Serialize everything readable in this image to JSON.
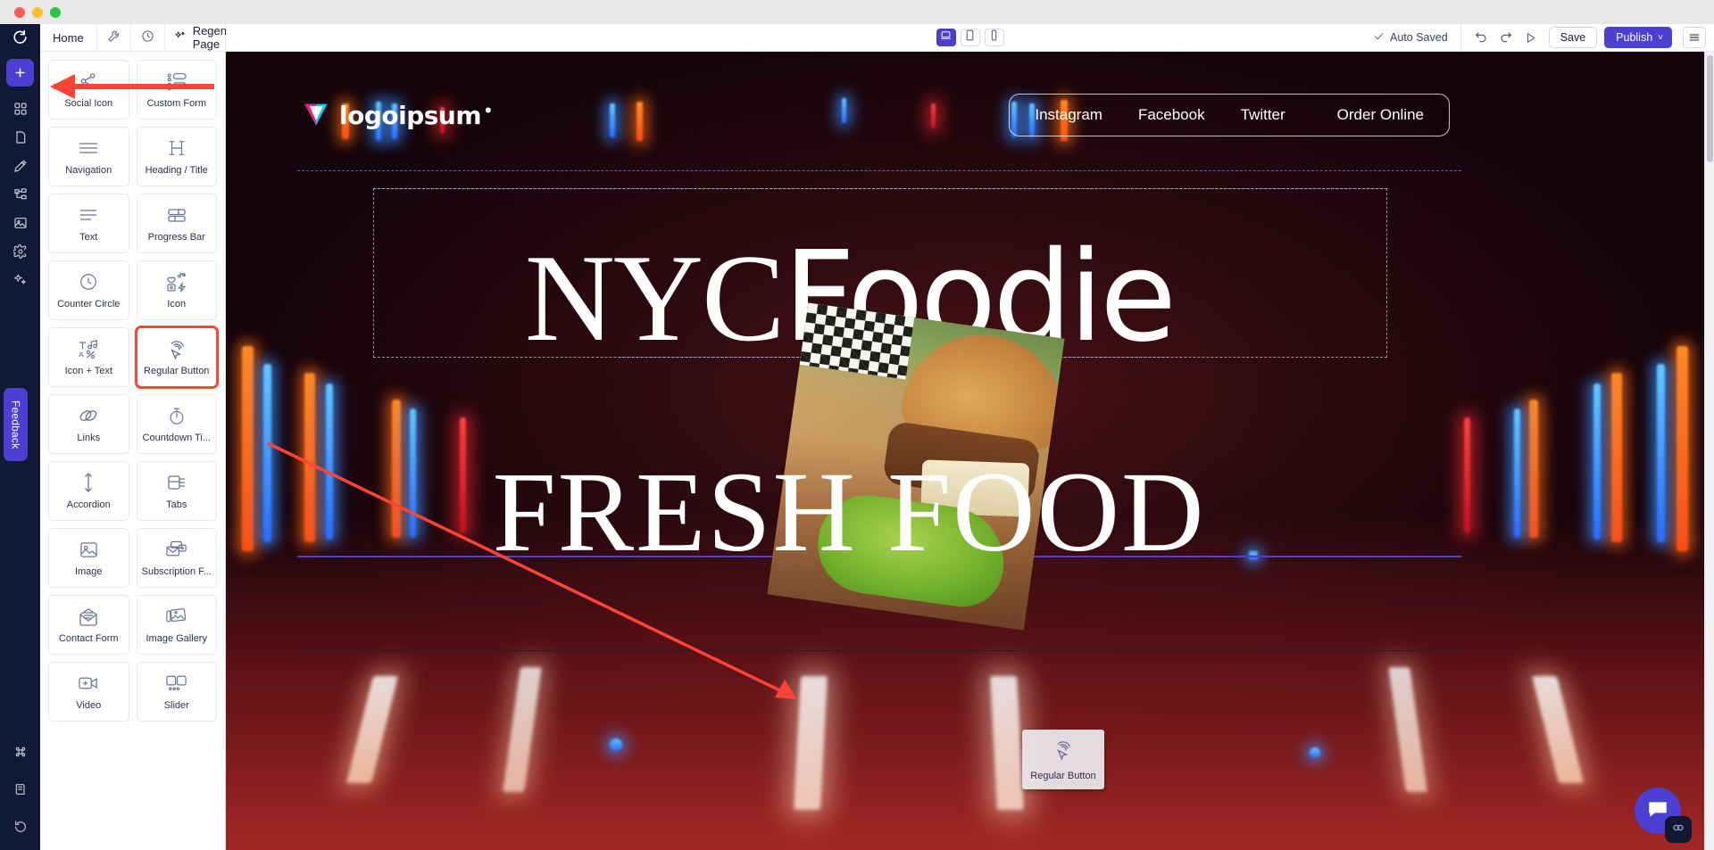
{
  "window": {
    "traffic_lights": [
      "close",
      "minimize",
      "maximize"
    ]
  },
  "rail": {
    "logo_icon": "refresh-logo-icon",
    "items": [
      {
        "name": "add-element",
        "icon": "plus-icon",
        "active": true
      },
      {
        "name": "sections",
        "icon": "grid-blocks-icon"
      },
      {
        "name": "pages",
        "icon": "page-icon"
      },
      {
        "name": "design",
        "icon": "brush-icon"
      },
      {
        "name": "layers",
        "icon": "tree-layers-icon"
      },
      {
        "name": "media",
        "icon": "image-icon"
      },
      {
        "name": "settings",
        "icon": "gear-icon"
      },
      {
        "name": "ai-assist",
        "icon": "sparkle-icon"
      }
    ],
    "feedback_label": "Feedback",
    "bottom_items": [
      {
        "name": "shortcuts",
        "icon": "command-icon"
      },
      {
        "name": "docs",
        "icon": "book-icon"
      },
      {
        "name": "history",
        "icon": "restore-icon"
      }
    ]
  },
  "panel": {
    "tabs": [
      {
        "label": "Home",
        "name": "tab-home",
        "icon": null
      },
      {
        "label": "",
        "name": "tab-tools",
        "icon": "wrench-icon"
      },
      {
        "label": "",
        "name": "tab-history",
        "icon": "clock-icon"
      }
    ],
    "regenerate": {
      "label": "Regenerate Page",
      "icon": "sparkle-icon",
      "chevron": "˅"
    },
    "widgets": [
      {
        "label": "Social Icon",
        "icon": "share-nodes-icon"
      },
      {
        "label": "Custom Form",
        "icon": "form-fields-icon"
      },
      {
        "label": "Navigation",
        "icon": "nav-lines-icon"
      },
      {
        "label": "Heading / Title",
        "icon": "heading-h-icon"
      },
      {
        "label": "Text",
        "icon": "text-lines-icon"
      },
      {
        "label": "Progress Bar",
        "icon": "progress-bars-icon"
      },
      {
        "label": "Counter Circle",
        "icon": "clock-circle-icon"
      },
      {
        "label": "Icon",
        "icon": "icon-set-icon"
      },
      {
        "label": "Icon + Text",
        "icon": "icon-text-icon"
      },
      {
        "label": "Regular Button",
        "icon": "cursor-click-icon",
        "selected": true
      },
      {
        "label": "Links",
        "icon": "chain-link-icon"
      },
      {
        "label": "Countdown Ti...",
        "icon": "stopwatch-icon"
      },
      {
        "label": "Accordion",
        "icon": "arrows-vertical-icon"
      },
      {
        "label": "Tabs",
        "icon": "tabs-panel-icon"
      },
      {
        "label": "Image",
        "icon": "image-icon"
      },
      {
        "label": "Subscription F...",
        "icon": "envelope-cards-icon"
      },
      {
        "label": "Contact Form",
        "icon": "envelope-open-icon"
      },
      {
        "label": "Image Gallery",
        "icon": "gallery-icon"
      },
      {
        "label": "Video",
        "icon": "video-plus-icon"
      },
      {
        "label": "Slider",
        "icon": "slider-cards-icon"
      }
    ]
  },
  "toolbar": {
    "devices": [
      {
        "name": "desktop",
        "icon": "laptop-icon",
        "active": true
      },
      {
        "name": "tablet",
        "icon": "tablet-icon",
        "active": false
      },
      {
        "name": "mobile",
        "icon": "phone-icon",
        "active": false
      }
    ],
    "auto_saved": "Auto Saved",
    "auto_saved_icon": "check-icon",
    "undo_icon": "undo-icon",
    "redo_icon": "redo-icon",
    "preview_icon": "play-triangle-icon",
    "save_label": "Save",
    "publish_label": "Publish",
    "publish_chevron": "˅",
    "menu_icon": "hamburger-icon"
  },
  "canvas": {
    "site": {
      "logo_text": "logoipsum",
      "logo_mark": "triangle-logo-icon",
      "nav": [
        {
          "label": "Instagram"
        },
        {
          "label": "Facebook"
        },
        {
          "label": "Twitter"
        },
        {
          "label": "Order Online"
        }
      ],
      "hero": {
        "line1_part1": "NYC",
        "line1_part2": "Foodie",
        "line2": "FRESH FOOD"
      },
      "food_image_alt": "burger-and-fries-photo"
    },
    "drag_ghost": {
      "label": "Regular Button",
      "icon": "cursor-click-icon"
    },
    "chat": {
      "fab_icon": "chat-bubble-icon",
      "badge_icon": "link-chain-icon"
    }
  },
  "colors": {
    "accent": "#4b3fd4",
    "rail_bg": "#101936",
    "annotation_red": "#ff4436",
    "guide_blue": "#4b3fd4"
  }
}
